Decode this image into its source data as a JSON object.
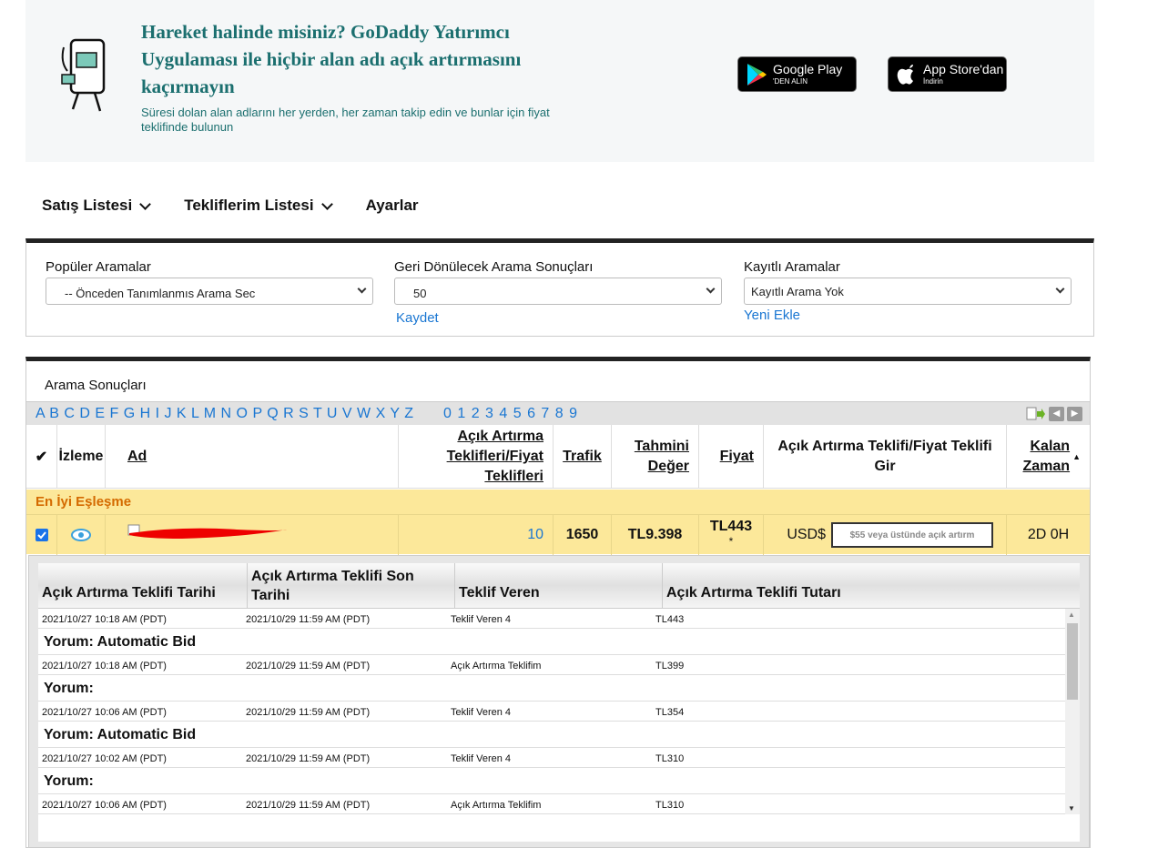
{
  "banner": {
    "title": "Hareket halinde misiniz? GoDaddy Yatırımcı Uygulaması ile hiçbir alan adı açık artırmasını kaçırmayın",
    "subtitle": "Süresi dolan alan adlarını her yerden, her zaman takip edin ve bunlar için fiyat teklifinde bulunun",
    "google_play": {
      "main": "Google Play",
      "small": "'DEN ALIN"
    },
    "app_store": {
      "main": "App Store'dan",
      "small": "İndirin"
    }
  },
  "nav": {
    "items": [
      "Satış Listesi",
      "Tekliflerim Listesi",
      "Ayarlar"
    ]
  },
  "search": {
    "popular_label": "Popüler Aramalar",
    "popular_value": "-- Önceden Tanımlanmıs Arama Sec",
    "results_label": "Geri Dönülecek Arama Sonuçları",
    "results_value": "50",
    "save_link": "Kaydet",
    "saved_label": "Kayıtlı Aramalar",
    "saved_value": "Kayıtlı Arama Yok",
    "new_link": "Yeni Ekle"
  },
  "results": {
    "title": "Arama Sonuçları",
    "letters": "A B C D E F G H I J K L M N O P Q R S T U V W X Y Z",
    "numbers": "0 1 2 3 4 5 6 7 8 9",
    "headers": {
      "watch": "İzleme",
      "name": "Ad",
      "bids": "Açık Artırma Teklifleri/Fiyat Teklifleri",
      "traffic": "Trafik",
      "estimate": "Tahmini Değer",
      "price": "Fiyat",
      "bid_entry": "Açık Artırma Teklifi/Fiyat Teklifi Gir",
      "time_left": "Kalan Zaman"
    },
    "best_match": "En İyi Eşleşme",
    "row": {
      "bids": "10",
      "traffic": "1650",
      "estimate": "TL9.398",
      "price": "TL443",
      "price_note": "*",
      "currency": "USD$",
      "bid_placeholder": "$55 veya üstünde açık artırm",
      "time_left": "2D 0H"
    }
  },
  "bid_history": {
    "headers": [
      "Açık Artırma Teklifi Tarihi",
      "Açık Artırma Teklifi Son Tarihi",
      "Teklif Veren",
      "Açık Artırma Teklifi Tutarı"
    ],
    "rows": [
      {
        "date": "2021/10/27 10:18 AM (PDT)",
        "end": "2021/10/29 11:59 AM (PDT)",
        "bidder": "Teklif Veren  4",
        "amount": "TL443",
        "comment": "Yorum: Automatic Bid"
      },
      {
        "date": "2021/10/27 10:18 AM (PDT)",
        "end": "2021/10/29 11:59 AM (PDT)",
        "bidder": "Açık Artırma Teklifim",
        "amount": "TL399",
        "comment": "Yorum:"
      },
      {
        "date": "2021/10/27 10:06 AM (PDT)",
        "end": "2021/10/29 11:59 AM (PDT)",
        "bidder": "Teklif Veren  4",
        "amount": "TL354",
        "comment": "Yorum: Automatic Bid"
      },
      {
        "date": "2021/10/27 10:02 AM (PDT)",
        "end": "2021/10/29 11:59 AM (PDT)",
        "bidder": "Teklif Veren  4",
        "amount": "TL310",
        "comment": "Yorum:"
      },
      {
        "date": "2021/10/27 10:06 AM (PDT)",
        "end": "2021/10/29 11:59 AM (PDT)",
        "bidder": "Açık Artırma Teklifim",
        "amount": "TL310",
        "comment": ""
      }
    ]
  }
}
